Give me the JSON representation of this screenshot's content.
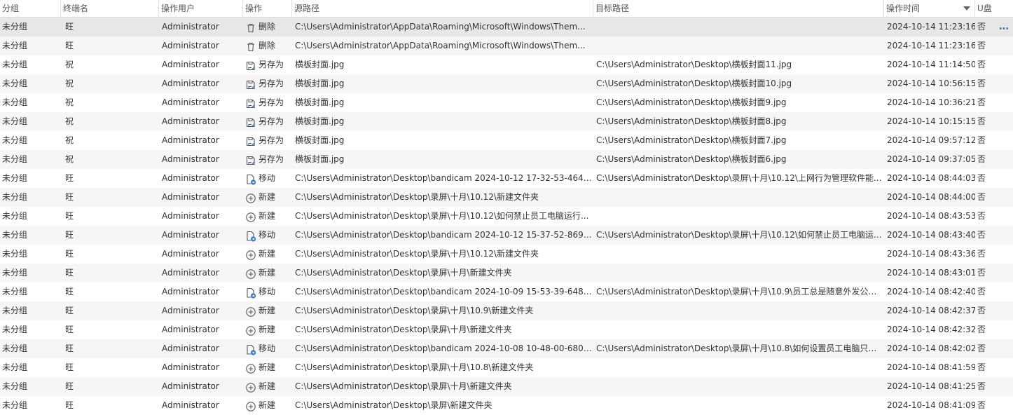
{
  "columns": {
    "group": "分组",
    "terminal": "终端名",
    "user": "操作用户",
    "operation": "操作",
    "source": "源路径",
    "target": "目标路径",
    "time": "操作时间",
    "usb": "U盘"
  },
  "more_icon": "…",
  "colors": {
    "selected_row": "#e7e7e7",
    "alt_row": "#f6f6f6",
    "icon_blue": "#2b78d6"
  },
  "rows": [
    {
      "group": "未分组",
      "terminal": "旺",
      "user": "Administrator",
      "op": "删除",
      "icon": "trash-icon",
      "source": "C:\\Users\\Administrator\\AppData\\Roaming\\Microsoft\\Windows\\Them...",
      "target": "",
      "time": "2024-10-14 11:23:16",
      "usb": "否"
    },
    {
      "group": "未分组",
      "terminal": "旺",
      "user": "Administrator",
      "op": "删除",
      "icon": "trash-icon",
      "source": "C:\\Users\\Administrator\\AppData\\Roaming\\Microsoft\\Windows\\Them...",
      "target": "",
      "time": "2024-10-14 11:23:16",
      "usb": "否"
    },
    {
      "group": "未分组",
      "terminal": "祝",
      "user": "Administrator",
      "op": "另存为",
      "icon": "save-as-icon",
      "source": "横板封面.jpg",
      "target": "C:\\Users\\Administrator\\Desktop\\横板封面11.jpg",
      "time": "2024-10-14 11:14:50",
      "usb": "否"
    },
    {
      "group": "未分组",
      "terminal": "祝",
      "user": "Administrator",
      "op": "另存为",
      "icon": "save-as-icon",
      "source": "横板封面.jpg",
      "target": "C:\\Users\\Administrator\\Desktop\\横板封面10.jpg",
      "time": "2024-10-14 10:56:15",
      "usb": "否"
    },
    {
      "group": "未分组",
      "terminal": "祝",
      "user": "Administrator",
      "op": "另存为",
      "icon": "save-as-icon",
      "source": "横板封面.jpg",
      "target": "C:\\Users\\Administrator\\Desktop\\横板封面9.jpg",
      "time": "2024-10-14 10:36:21",
      "usb": "否"
    },
    {
      "group": "未分组",
      "terminal": "祝",
      "user": "Administrator",
      "op": "另存为",
      "icon": "save-as-icon",
      "source": "横板封面.jpg",
      "target": "C:\\Users\\Administrator\\Desktop\\横板封面8.jpg",
      "time": "2024-10-14 10:15:15",
      "usb": "否"
    },
    {
      "group": "未分组",
      "terminal": "祝",
      "user": "Administrator",
      "op": "另存为",
      "icon": "save-as-icon",
      "source": "横板封面.jpg",
      "target": "C:\\Users\\Administrator\\Desktop\\横板封面7.jpg",
      "time": "2024-10-14 09:57:12",
      "usb": "否"
    },
    {
      "group": "未分组",
      "terminal": "祝",
      "user": "Administrator",
      "op": "另存为",
      "icon": "save-as-icon",
      "source": "横板封面.jpg",
      "target": "C:\\Users\\Administrator\\Desktop\\横板封面6.jpg",
      "time": "2024-10-14 09:37:05",
      "usb": "否"
    },
    {
      "group": "未分组",
      "terminal": "旺",
      "user": "Administrator",
      "op": "移动",
      "icon": "move-file-icon",
      "source": "C:\\Users\\Administrator\\Desktop\\bandicam 2024-10-12 17-32-53-464....",
      "target": "C:\\Users\\Administrator\\Desktop\\录屏\\十月\\10.12\\上网行为管理软件能...",
      "time": "2024-10-14 08:44:03",
      "usb": "否"
    },
    {
      "group": "未分组",
      "terminal": "旺",
      "user": "Administrator",
      "op": "新建",
      "icon": "add-circle-icon",
      "source": "C:\\Users\\Administrator\\Desktop\\录屏\\十月\\10.12\\新建文件夹",
      "target": "",
      "time": "2024-10-14 08:44:00",
      "usb": "否"
    },
    {
      "group": "未分组",
      "terminal": "旺",
      "user": "Administrator",
      "op": "新建",
      "icon": "add-circle-icon",
      "source": "C:\\Users\\Administrator\\Desktop\\录屏\\十月\\10.12\\如何禁止员工电脑运行...",
      "target": "",
      "time": "2024-10-14 08:43:53",
      "usb": "否"
    },
    {
      "group": "未分组",
      "terminal": "旺",
      "user": "Administrator",
      "op": "移动",
      "icon": "move-file-icon",
      "source": "C:\\Users\\Administrator\\Desktop\\bandicam 2024-10-12 15-37-52-869....",
      "target": "C:\\Users\\Administrator\\Desktop\\录屏\\十月\\10.12\\如何禁止员工电脑运...",
      "time": "2024-10-14 08:43:40",
      "usb": "否"
    },
    {
      "group": "未分组",
      "terminal": "旺",
      "user": "Administrator",
      "op": "新建",
      "icon": "add-circle-icon",
      "source": "C:\\Users\\Administrator\\Desktop\\录屏\\十月\\10.12\\新建文件夹",
      "target": "",
      "time": "2024-10-14 08:43:36",
      "usb": "否"
    },
    {
      "group": "未分组",
      "terminal": "旺",
      "user": "Administrator",
      "op": "新建",
      "icon": "add-circle-icon",
      "source": "C:\\Users\\Administrator\\Desktop\\录屏\\十月\\新建文件夹",
      "target": "",
      "time": "2024-10-14 08:43:01",
      "usb": "否"
    },
    {
      "group": "未分组",
      "terminal": "旺",
      "user": "Administrator",
      "op": "移动",
      "icon": "move-file-icon",
      "source": "C:\\Users\\Administrator\\Desktop\\bandicam 2024-10-09 15-53-39-648....",
      "target": "C:\\Users\\Administrator\\Desktop\\录屏\\十月\\10.9\\员工总是随意外发公司...",
      "time": "2024-10-14 08:42:40",
      "usb": "否"
    },
    {
      "group": "未分组",
      "terminal": "旺",
      "user": "Administrator",
      "op": "新建",
      "icon": "add-circle-icon",
      "source": "C:\\Users\\Administrator\\Desktop\\录屏\\十月\\10.9\\新建文件夹",
      "target": "",
      "time": "2024-10-14 08:42:37",
      "usb": "否"
    },
    {
      "group": "未分组",
      "terminal": "旺",
      "user": "Administrator",
      "op": "新建",
      "icon": "add-circle-icon",
      "source": "C:\\Users\\Administrator\\Desktop\\录屏\\十月\\新建文件夹",
      "target": "",
      "time": "2024-10-14 08:42:32",
      "usb": "否"
    },
    {
      "group": "未分组",
      "terminal": "旺",
      "user": "Administrator",
      "op": "移动",
      "icon": "move-file-icon",
      "source": "C:\\Users\\Administrator\\Desktop\\bandicam 2024-10-08 10-48-00-680....",
      "target": "C:\\Users\\Administrator\\Desktop\\录屏\\十月\\10.8\\如何设置员工电脑只允...",
      "time": "2024-10-14 08:42:02",
      "usb": "否"
    },
    {
      "group": "未分组",
      "terminal": "旺",
      "user": "Administrator",
      "op": "新建",
      "icon": "add-circle-icon",
      "source": "C:\\Users\\Administrator\\Desktop\\录屏\\十月\\10.8\\新建文件夹",
      "target": "",
      "time": "2024-10-14 08:41:59",
      "usb": "否"
    },
    {
      "group": "未分组",
      "terminal": "旺",
      "user": "Administrator",
      "op": "新建",
      "icon": "add-circle-icon",
      "source": "C:\\Users\\Administrator\\Desktop\\录屏\\十月\\新建文件夹",
      "target": "",
      "time": "2024-10-14 08:41:25",
      "usb": "否"
    },
    {
      "group": "未分组",
      "terminal": "旺",
      "user": "Administrator",
      "op": "新建",
      "icon": "add-circle-icon",
      "source": "C:\\Users\\Administrator\\Desktop\\录屏\\新建文件夹",
      "target": "",
      "time": "2024-10-14 08:41:09",
      "usb": "否"
    }
  ]
}
